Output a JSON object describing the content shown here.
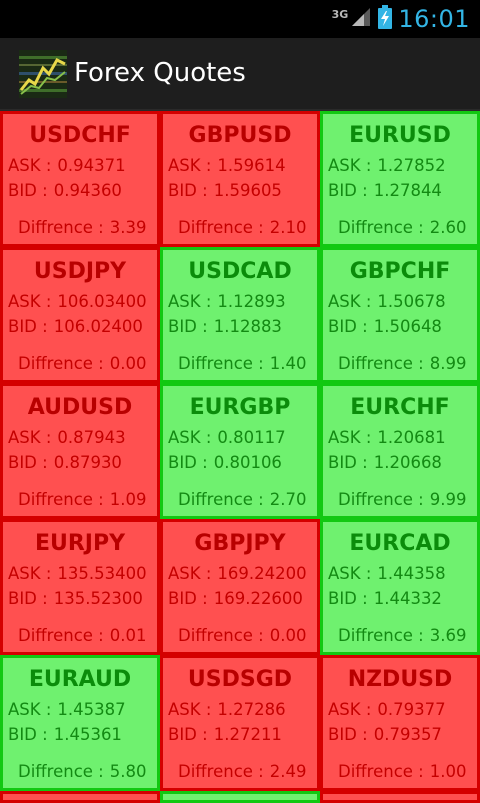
{
  "status": {
    "network": "3G",
    "time": "16:01"
  },
  "app": {
    "title": "Forex Quotes"
  },
  "labels": {
    "ask": "ASK :",
    "bid": "BID :",
    "diff": "Diffrence :"
  },
  "colors": {
    "red_bg": "#ff5050",
    "red_text": "#c40000",
    "green_bg": "#6ff16f",
    "green_text": "#138a13",
    "accent": "#33b5e5"
  },
  "quotes": [
    {
      "pair": "USDCHF",
      "ask": "0.94371",
      "bid": "0.94360",
      "diff": "3.39",
      "state": "red"
    },
    {
      "pair": "GBPUSD",
      "ask": "1.59614",
      "bid": "1.59605",
      "diff": "2.10",
      "state": "red"
    },
    {
      "pair": "EURUSD",
      "ask": "1.27852",
      "bid": "1.27844",
      "diff": "2.60",
      "state": "green"
    },
    {
      "pair": "USDJPY",
      "ask": "106.03400",
      "bid": "106.02400",
      "diff": "0.00",
      "state": "red"
    },
    {
      "pair": "USDCAD",
      "ask": "1.12893",
      "bid": "1.12883",
      "diff": "1.40",
      "state": "green"
    },
    {
      "pair": "GBPCHF",
      "ask": "1.50678",
      "bid": "1.50648",
      "diff": "8.99",
      "state": "green"
    },
    {
      "pair": "AUDUSD",
      "ask": "0.87943",
      "bid": "0.87930",
      "diff": "1.09",
      "state": "red"
    },
    {
      "pair": "EURGBP",
      "ask": "0.80117",
      "bid": "0.80106",
      "diff": "2.70",
      "state": "green"
    },
    {
      "pair": "EURCHF",
      "ask": "1.20681",
      "bid": "1.20668",
      "diff": "9.99",
      "state": "green"
    },
    {
      "pair": "EURJPY",
      "ask": "135.53400",
      "bid": "135.52300",
      "diff": "0.01",
      "state": "red"
    },
    {
      "pair": "GBPJPY",
      "ask": "169.24200",
      "bid": "169.22600",
      "diff": "0.00",
      "state": "red"
    },
    {
      "pair": "EURCAD",
      "ask": "1.44358",
      "bid": "1.44332",
      "diff": "3.69",
      "state": "green"
    },
    {
      "pair": "EURAUD",
      "ask": "1.45387",
      "bid": "1.45361",
      "diff": "5.80",
      "state": "green"
    },
    {
      "pair": "USDSGD",
      "ask": "1.27286",
      "bid": "1.27211",
      "diff": "2.49",
      "state": "red"
    },
    {
      "pair": "NZDUSD",
      "ask": "0.79377",
      "bid": "0.79357",
      "diff": "1.00",
      "state": "red"
    }
  ],
  "partial_row": [
    "red",
    "green",
    "red"
  ]
}
